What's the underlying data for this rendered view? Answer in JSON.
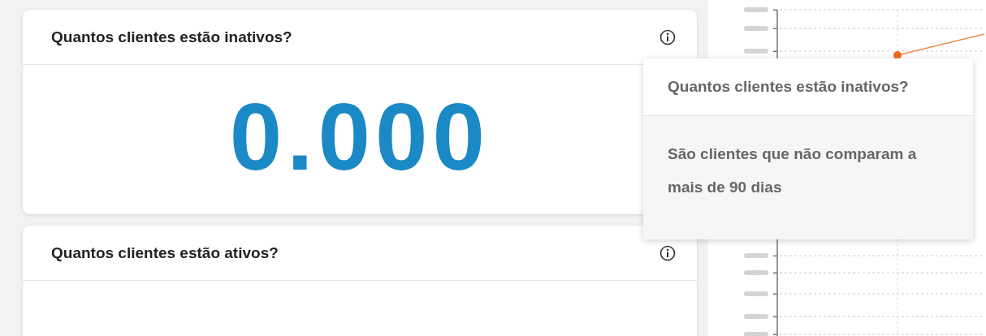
{
  "cards": [
    {
      "title": "Quantos clientes estão inativos?",
      "value": "0.000"
    },
    {
      "title": "Quantos clientes estão ativos?"
    }
  ],
  "tooltip": {
    "title": "Quantos clientes estão inativos?",
    "body": "São clientes que não comparam a mais de 90 dias"
  }
}
